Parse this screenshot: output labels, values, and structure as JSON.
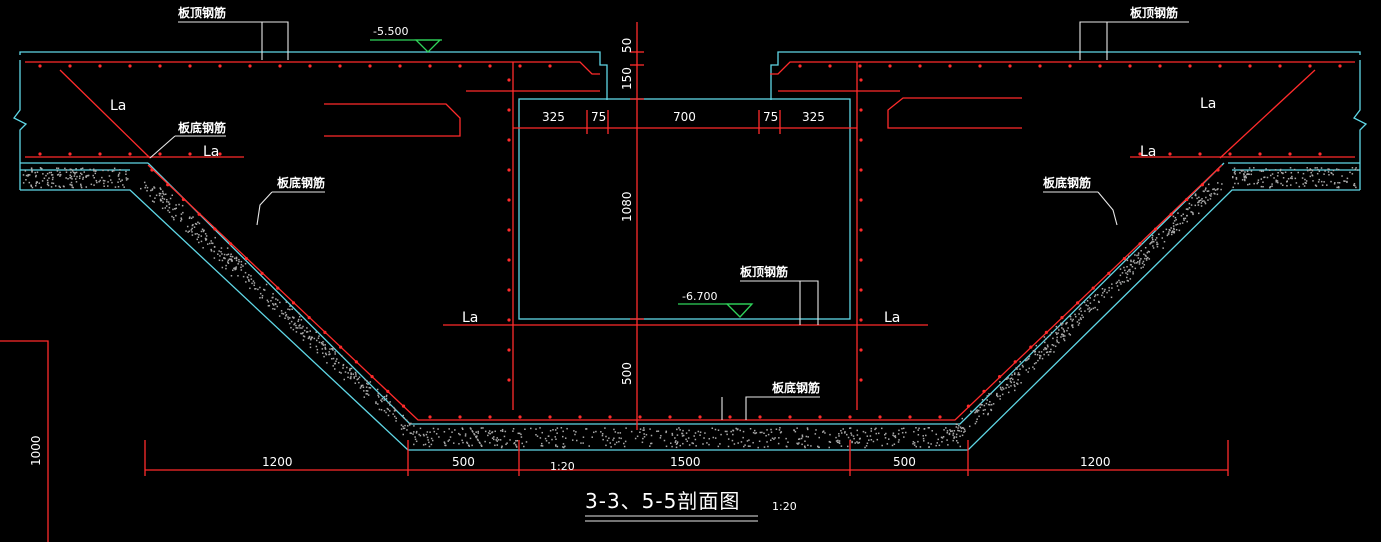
{
  "labels": {
    "top_rebar": "板顶钢筋",
    "bottom_rebar": "板底钢筋",
    "anchorage": "La"
  },
  "elevations": {
    "top": "-5.500",
    "bottom": "-6.700"
  },
  "dimensions": {
    "horizontal_bottom": [
      "1200",
      "500",
      "1500",
      "500",
      "1200"
    ],
    "opening_top": [
      "325",
      "75",
      "700",
      "75",
      "325"
    ],
    "vertical": [
      "50",
      "150",
      "1080",
      "500"
    ],
    "left_edge": "1000"
  },
  "title": {
    "text": "3-3、5-5剖面图",
    "scale": "1:20",
    "scale_small": "1:20"
  },
  "colors": {
    "background": "#000000",
    "outline": "#5fd7e6",
    "rebar": "#ff2b2b",
    "text": "#ffffff",
    "elevation_marker": "#2fd35a"
  }
}
